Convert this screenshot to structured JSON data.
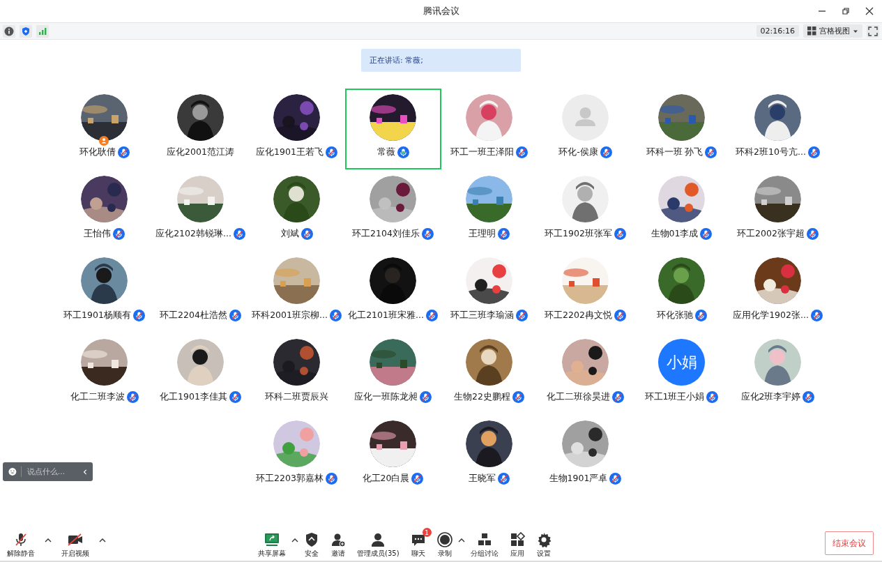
{
  "window": {
    "title": "腾讯会议"
  },
  "toolbar": {
    "timer": "02:16:16",
    "view_button": "宫格视图"
  },
  "speaking_banner": "正在讲话: 常薇;",
  "participants": [
    {
      "name": "环化耿倩",
      "muted": true,
      "speaking": false,
      "host": true,
      "selected": false
    },
    {
      "name": "应化2001范江涛",
      "muted": false,
      "speaking": false,
      "host": false,
      "selected": false
    },
    {
      "name": "应化1901王若飞",
      "muted": true,
      "speaking": false,
      "host": false,
      "selected": false
    },
    {
      "name": "常薇",
      "muted": false,
      "speaking": true,
      "host": false,
      "selected": true
    },
    {
      "name": "环工一班王泽阳",
      "muted": true,
      "speaking": false,
      "host": false,
      "selected": false
    },
    {
      "name": "环化-侯康",
      "avatar": {
        "kind": "default"
      },
      "muted": true,
      "speaking": false,
      "host": false,
      "selected": false
    },
    {
      "name": "环科一班 孙飞",
      "muted": true,
      "speaking": false,
      "host": false,
      "selected": false
    },
    {
      "name": "环科2班10号亢...",
      "muted": true,
      "speaking": false,
      "host": false,
      "selected": false
    },
    {
      "name": "王怡伟",
      "muted": true,
      "speaking": false,
      "host": false,
      "selected": false
    },
    {
      "name": "应化2102韩锐琳...",
      "muted": true,
      "speaking": false,
      "host": false,
      "selected": false
    },
    {
      "name": "刘斌",
      "muted": true,
      "speaking": false,
      "host": false,
      "selected": false
    },
    {
      "name": "环工2104刘佳乐",
      "muted": true,
      "speaking": false,
      "host": false,
      "selected": false
    },
    {
      "name": "王理明",
      "muted": true,
      "speaking": false,
      "host": false,
      "selected": false
    },
    {
      "name": "环工1902班张军",
      "muted": true,
      "speaking": false,
      "host": false,
      "selected": false
    },
    {
      "name": "生物01李成",
      "muted": true,
      "speaking": false,
      "host": false,
      "selected": false
    },
    {
      "name": "环工2002张宇超",
      "muted": true,
      "speaking": false,
      "host": false,
      "selected": false
    },
    {
      "name": "环工1901杨顺有",
      "muted": true,
      "speaking": false,
      "host": false,
      "selected": false
    },
    {
      "name": "环工2204杜浩然",
      "muted": true,
      "speaking": false,
      "host": false,
      "selected": false
    },
    {
      "name": "环科2001班宗柳...",
      "muted": true,
      "speaking": false,
      "host": false,
      "selected": false
    },
    {
      "name": "化工2101班宋雅...",
      "muted": true,
      "speaking": false,
      "host": false,
      "selected": false
    },
    {
      "name": "环工三班李瑜涵",
      "muted": true,
      "speaking": false,
      "host": false,
      "selected": false
    },
    {
      "name": "环工2202冉文悦",
      "muted": true,
      "speaking": false,
      "host": false,
      "selected": false
    },
    {
      "name": "环化张驰",
      "muted": true,
      "speaking": false,
      "host": false,
      "selected": false
    },
    {
      "name": "应用化学1902张...",
      "muted": true,
      "speaking": false,
      "host": false,
      "selected": false
    },
    {
      "name": "化工二班李波",
      "muted": true,
      "speaking": false,
      "host": false,
      "selected": false
    },
    {
      "name": "化工1901李佳其",
      "muted": true,
      "speaking": false,
      "host": false,
      "selected": false
    },
    {
      "name": "环科二班贾辰兴",
      "muted": false,
      "speaking": false,
      "host": false,
      "selected": false
    },
    {
      "name": "应化一班陈龙昶",
      "muted": true,
      "speaking": false,
      "host": false,
      "selected": false
    },
    {
      "name": "生物22史鹏程",
      "muted": true,
      "speaking": false,
      "host": false,
      "selected": false
    },
    {
      "name": "化工二班徐昊进",
      "muted": true,
      "speaking": false,
      "host": false,
      "selected": false
    },
    {
      "name": "环工1班王小娟",
      "avatar": {
        "kind": "text",
        "text": "小娟"
      },
      "muted": true,
      "speaking": false,
      "host": false,
      "selected": false
    },
    {
      "name": "应化2班李宇婷",
      "muted": true,
      "speaking": false,
      "host": false,
      "selected": false
    },
    {
      "name": "环工2203郭嘉林",
      "muted": true,
      "speaking": false,
      "host": false,
      "selected": false
    },
    {
      "name": "化工20白晨",
      "muted": true,
      "speaking": false,
      "host": false,
      "selected": false
    },
    {
      "name": "王晓军",
      "muted": true,
      "speaking": false,
      "host": false,
      "selected": false
    },
    {
      "name": "生物1901严卓",
      "muted": true,
      "speaking": false,
      "host": false,
      "selected": false
    }
  ],
  "chat_input": {
    "placeholder": "说点什么..."
  },
  "bottom_toolbar": {
    "left": [
      {
        "kind": "mic",
        "label": "解除静音",
        "caret": true
      },
      {
        "kind": "video",
        "label": "开启视频",
        "caret": true
      }
    ],
    "center": [
      {
        "kind": "share",
        "label": "共享屏幕",
        "caret": true
      },
      {
        "kind": "security",
        "label": "安全",
        "caret": false
      },
      {
        "kind": "invite",
        "label": "邀请",
        "caret": false
      },
      {
        "kind": "members",
        "label": "管理成员(35)",
        "caret": false
      },
      {
        "kind": "chat",
        "label": "聊天",
        "caret": false,
        "badge": "1"
      },
      {
        "kind": "record",
        "label": "录制",
        "caret": true
      },
      {
        "kind": "breakout",
        "label": "分组讨论",
        "caret": false
      },
      {
        "kind": "apps",
        "label": "应用",
        "caret": false
      },
      {
        "kind": "settings",
        "label": "设置",
        "caret": false
      }
    ],
    "end_button": "结束会议"
  }
}
